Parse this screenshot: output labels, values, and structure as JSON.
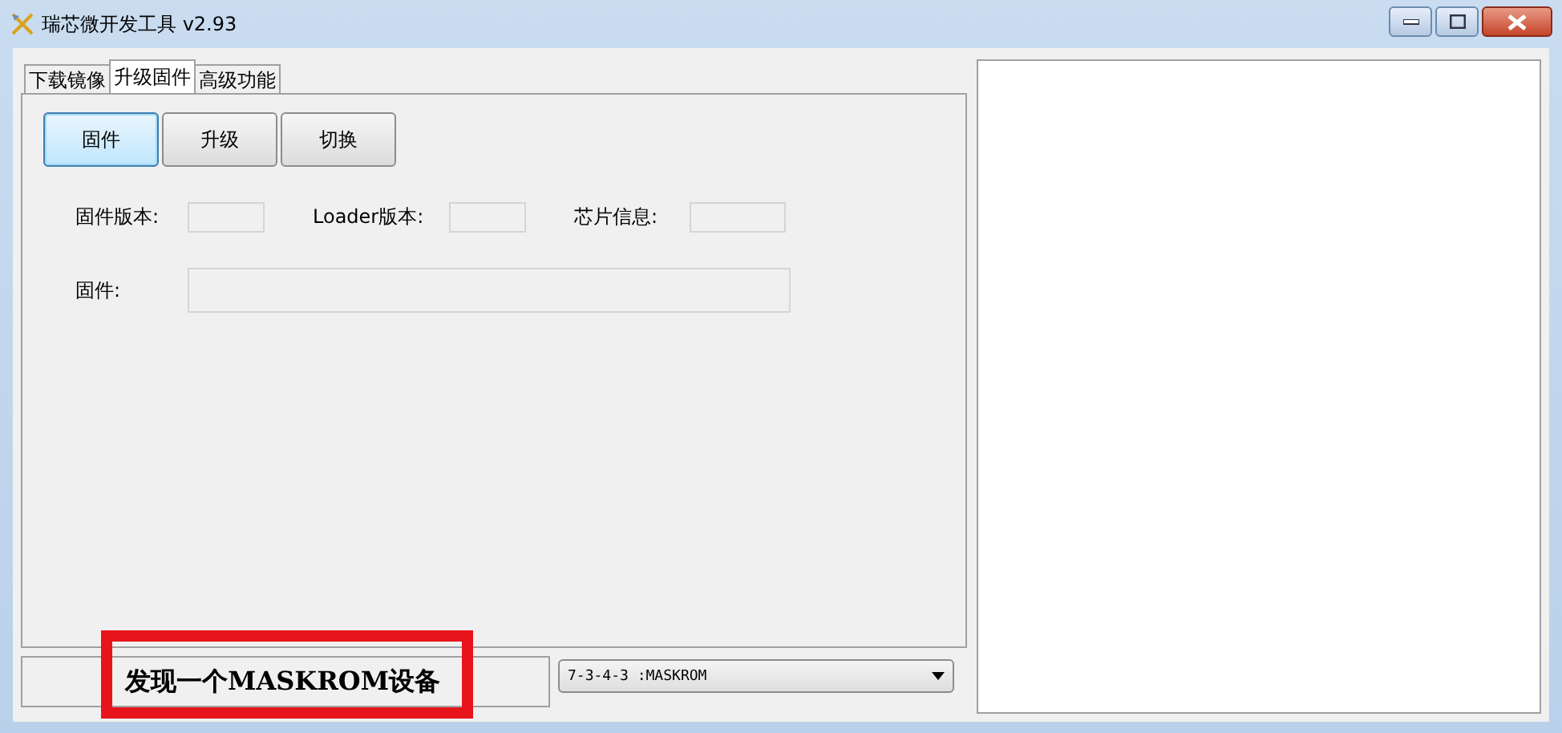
{
  "window": {
    "title": "瑞芯微开发工具 v2.93"
  },
  "tabs": [
    {
      "label": "下载镜像",
      "selected": false
    },
    {
      "label": "升级固件",
      "selected": true
    },
    {
      "label": "高级功能",
      "selected": false
    }
  ],
  "buttons": [
    {
      "label": "固件",
      "selected": true
    },
    {
      "label": "升级",
      "selected": false
    },
    {
      "label": "切换",
      "selected": false
    }
  ],
  "info_fields": [
    {
      "label": "固件版本:"
    },
    {
      "label": "Loader版本:"
    },
    {
      "label": "芯片信息:"
    }
  ],
  "firmware_field": {
    "label": "固件:"
  },
  "status": {
    "text": "发现一个MASKROM设备",
    "highlighted": true
  },
  "device_select": {
    "value": "7-3-4-3 :MASKROM"
  }
}
